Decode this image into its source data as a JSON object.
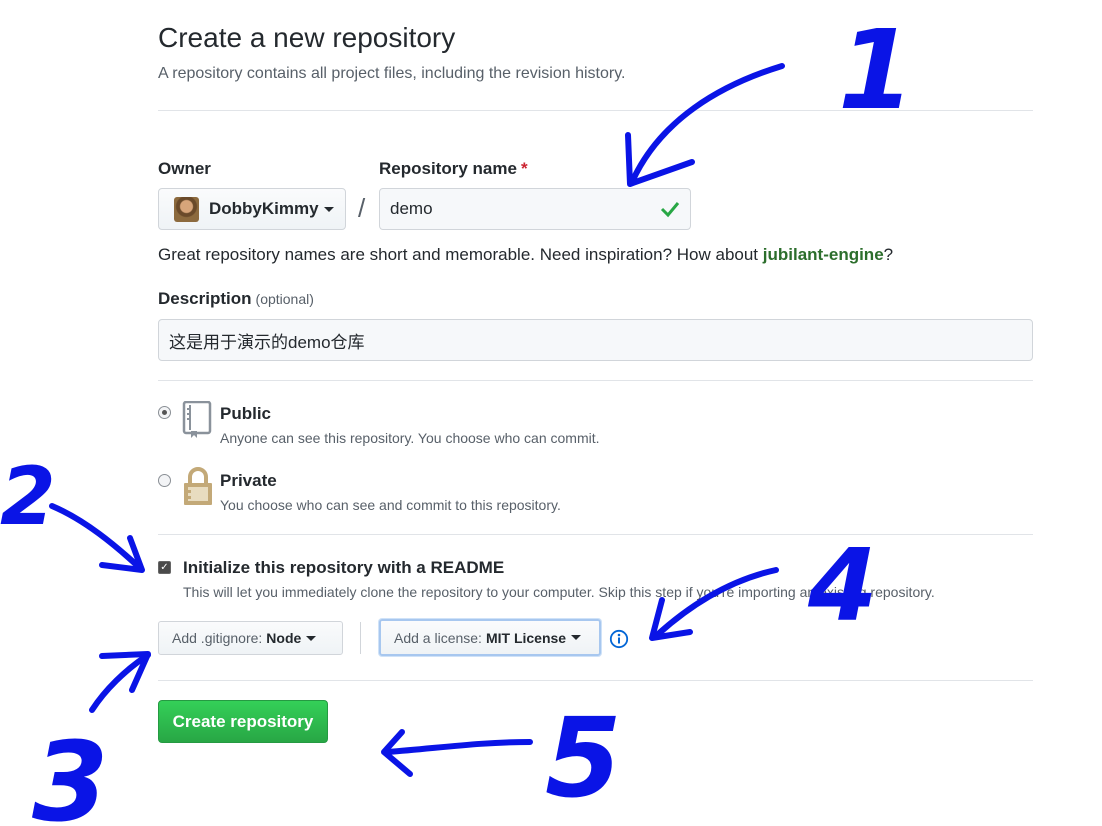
{
  "header": {
    "title": "Create a new repository",
    "subtitle": "A repository contains all project files, including the revision history."
  },
  "owner": {
    "label": "Owner",
    "value": "DobbyKimmy"
  },
  "separator": "/",
  "repo_name": {
    "label": "Repository name",
    "required_mark": "*",
    "value": "demo"
  },
  "name_hint": {
    "before": "Great repository names are short and memorable. Need inspiration? How about ",
    "suggestion": "jubilant-engine",
    "after": "?"
  },
  "description": {
    "label": "Description",
    "optional": "(optional)",
    "value": "这是用于演示的demo仓库"
  },
  "visibility": {
    "public": {
      "title": "Public",
      "desc": "Anyone can see this repository. You choose who can commit.",
      "selected": true
    },
    "private": {
      "title": "Private",
      "desc": "You choose who can see and commit to this repository.",
      "selected": false
    }
  },
  "readme": {
    "label": "Initialize this repository with a README",
    "desc": "This will let you immediately clone the repository to your computer. Skip this step if you're importing an existing repository.",
    "checked": true
  },
  "gitignore": {
    "prefix": "Add .gitignore:",
    "value": "Node"
  },
  "license": {
    "prefix": "Add a license:",
    "value": "MIT License"
  },
  "submit": {
    "label": "Create repository"
  },
  "annotations": {
    "labels": [
      "1",
      "2",
      "3",
      "4",
      "5"
    ],
    "color": "#0a14e6"
  }
}
